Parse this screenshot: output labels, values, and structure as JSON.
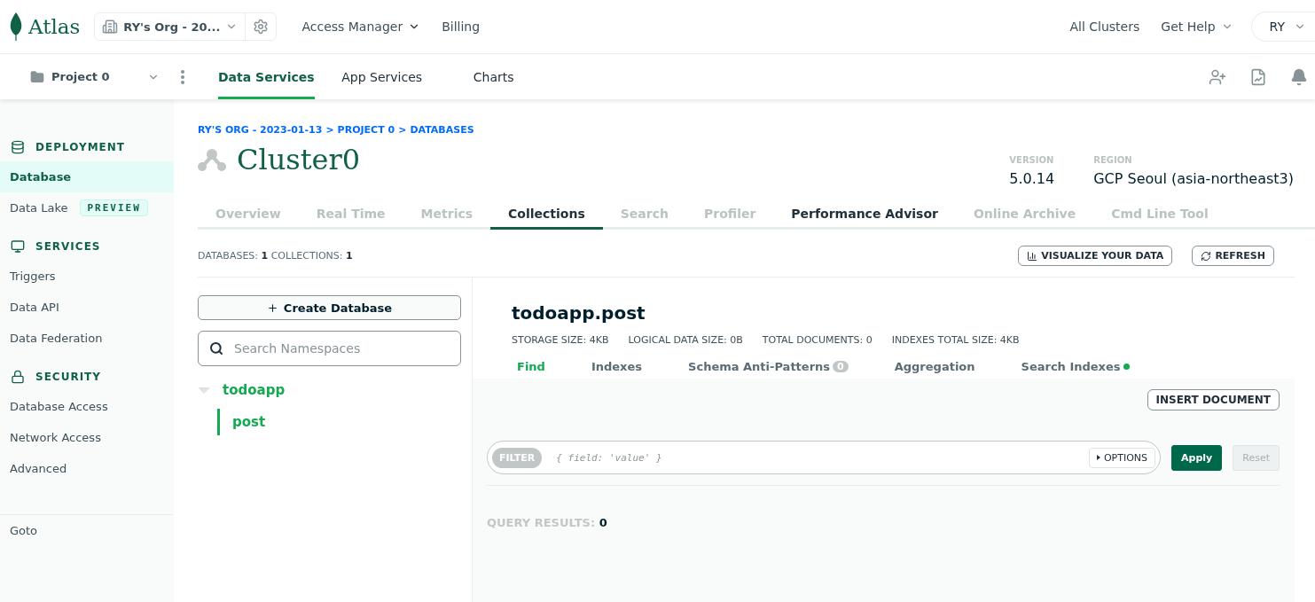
{
  "topbar": {
    "logo": "Atlas",
    "org": "RY's Org - 20...",
    "nav": [
      {
        "label": "Access Manager",
        "dropdown": true
      },
      {
        "label": "Billing",
        "dropdown": false
      }
    ],
    "right": [
      {
        "label": "All Clusters",
        "dropdown": false
      },
      {
        "label": "Get Help",
        "dropdown": true
      }
    ],
    "user": "RY"
  },
  "subnav": {
    "project": "Project 0",
    "tabs": [
      {
        "label": "Data Services",
        "selected": true
      },
      {
        "label": "App Services",
        "selected": false
      },
      {
        "label": "Charts",
        "selected": false
      }
    ]
  },
  "sidebar": {
    "sections": [
      {
        "title": "DEPLOYMENT",
        "kind": "database",
        "items": [
          {
            "label": "Database",
            "selected": true
          },
          {
            "label": "Data Lake",
            "selected": false,
            "badge": "PREVIEW"
          }
        ]
      },
      {
        "title": "SERVICES",
        "kind": "services",
        "items": [
          {
            "label": "Triggers",
            "selected": false
          },
          {
            "label": "Data API",
            "selected": false
          },
          {
            "label": "Data Federation",
            "selected": false
          }
        ]
      },
      {
        "title": "SECURITY",
        "kind": "lock",
        "items": [
          {
            "label": "Database Access",
            "selected": false
          },
          {
            "label": "Network Access",
            "selected": false
          },
          {
            "label": "Advanced",
            "selected": false
          }
        ]
      }
    ],
    "footer": "Goto"
  },
  "breadcrumb": {
    "parts": [
      "RY'S ORG - 2023-01-13",
      "PROJECT 0",
      "DATABASES"
    ],
    "separator": ">"
  },
  "cluster": {
    "name": "Cluster0",
    "meta": [
      {
        "label": "VERSION",
        "value": "5.0.14"
      },
      {
        "label": "REGION",
        "value": "GCP Seoul (asia-northeast3)"
      }
    ]
  },
  "tabs": [
    {
      "label": "Overview",
      "selected": false,
      "disabled": true
    },
    {
      "label": "Real Time",
      "selected": false,
      "disabled": true
    },
    {
      "label": "Metrics",
      "selected": false,
      "disabled": true
    },
    {
      "label": "Collections",
      "selected": true,
      "disabled": false
    },
    {
      "label": "Search",
      "selected": false,
      "disabled": true
    },
    {
      "label": "Profiler",
      "selected": false,
      "disabled": true
    },
    {
      "label": "Performance Advisor",
      "selected": false,
      "disabled": false
    },
    {
      "label": "Online Archive",
      "selected": false,
      "disabled": true
    },
    {
      "label": "Cmd Line Tool",
      "selected": false,
      "disabled": true
    }
  ],
  "counts": [
    {
      "label": "DATABASES:",
      "value": "1"
    },
    {
      "label": "COLLECTIONS:",
      "value": "1"
    }
  ],
  "actions": [
    "VISUALIZE YOUR DATA",
    "REFRESH"
  ],
  "create_button": "Create Database",
  "search": {
    "placeholder": "Search Namespaces"
  },
  "tree": [
    {
      "label": "todoapp",
      "expanded": true,
      "children": [
        {
          "label": "post",
          "selected": true
        }
      ]
    }
  ],
  "collection": {
    "title": "todoapp.post",
    "stats": [
      {
        "label": "STORAGE SIZE:",
        "value": "4KB"
      },
      {
        "label": "LOGICAL DATA SIZE:",
        "value": "0B"
      },
      {
        "label": "TOTAL DOCUMENTS:",
        "value": "0"
      },
      {
        "label": "INDEXES TOTAL SIZE:",
        "value": "4KB"
      }
    ],
    "tabs": [
      {
        "label": "Find",
        "selected": true
      },
      {
        "label": "Indexes",
        "selected": false
      },
      {
        "label": "Schema Anti-Patterns",
        "selected": false,
        "count": "0"
      },
      {
        "label": "Aggregation",
        "selected": false
      },
      {
        "label": "Search Indexes",
        "selected": false,
        "color": "#13aa52"
      }
    ],
    "insert_button": "INSERT DOCUMENT",
    "filter": {
      "tag": "FILTER",
      "placeholder": "{ field: 'value' }",
      "options": "OPTIONS"
    },
    "apply": "Apply",
    "reset": {
      "label": "Reset",
      "disabled": true
    },
    "results": {
      "label": "QUERY RESULTS:",
      "value": "0"
    }
  }
}
